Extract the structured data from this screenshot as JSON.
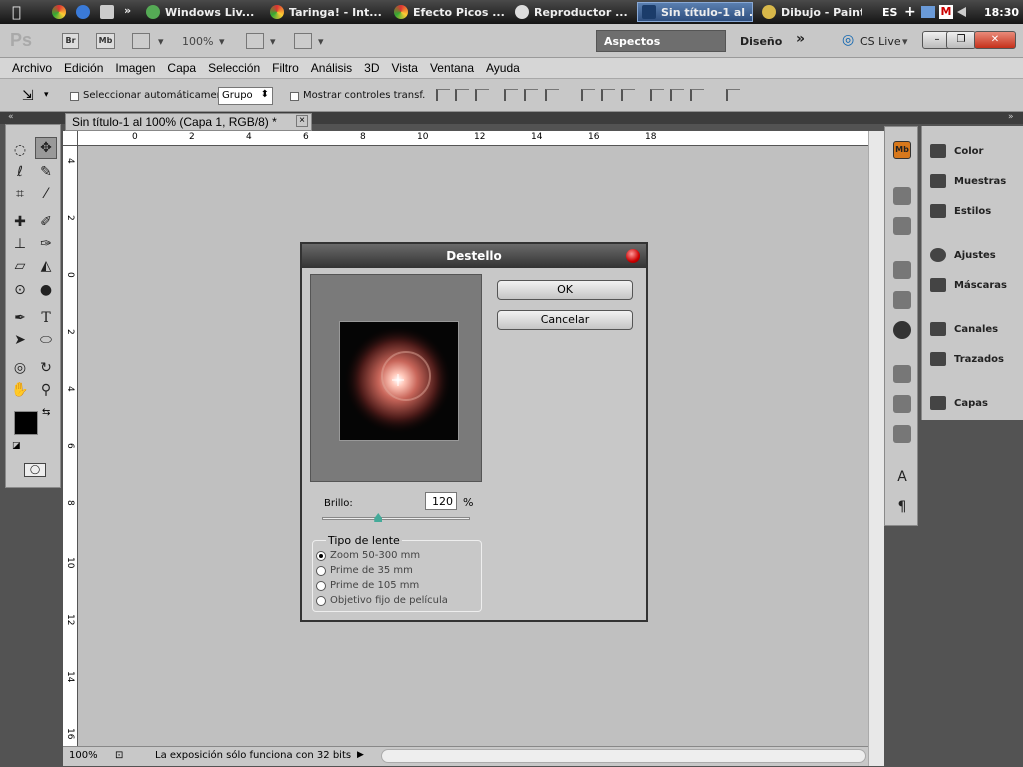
{
  "taskbar": {
    "items": [
      {
        "label": "Windows Liv..."
      },
      {
        "label": "Taringa! - Int..."
      },
      {
        "label": "Efecto Picos ..."
      },
      {
        "label": "Reproductor ..."
      },
      {
        "label": "Sin título-1 al ..."
      },
      {
        "label": "Dibujo - Paint"
      }
    ],
    "lang": "ES",
    "clock": "18:30",
    "more": "»"
  },
  "appbar": {
    "logo": "Ps",
    "br": "Br",
    "mb": "Mb",
    "zoom": "100%",
    "workspace_active": "Aspectos esenciales",
    "workspace_design": "Diseño",
    "workspace_more": "»",
    "cslive": "CS Live"
  },
  "menu": [
    "Archivo",
    "Edición",
    "Imagen",
    "Capa",
    "Selección",
    "Filtro",
    "Análisis",
    "3D",
    "Vista",
    "Ventana",
    "Ayuda"
  ],
  "options": {
    "auto_select": "Seleccionar automáticamente:",
    "auto_select_value": "Grupo",
    "transform": "Mostrar controles transf."
  },
  "document": {
    "tab": "Sin título-1 al 100% (Capa 1, RGB/8) *",
    "close": "×",
    "hruler": [
      "4",
      "2",
      "0",
      "2",
      "4",
      "6",
      "8",
      "10",
      "12",
      "14",
      "16",
      "18"
    ],
    "vruler": [
      "4",
      "2",
      "0",
      "2",
      "4",
      "6",
      "8",
      "10",
      "12",
      "14",
      "16"
    ],
    "zoom": "100%",
    "status": "La exposición sólo funciona con 32 bits"
  },
  "dialog": {
    "title": "Destello",
    "ok": "OK",
    "cancel": "Cancelar",
    "brightness_label": "Brillo:",
    "brightness_value": "120",
    "brightness_unit": "%",
    "brightness_slider": 0.38,
    "lens_group": "Tipo de lente",
    "lens_options": [
      "Zoom 50-300 mm",
      "Prime de 35 mm",
      "Prime de 105 mm",
      "Objetivo fijo de película"
    ],
    "lens_selected": 0
  },
  "panels": [
    {
      "label": "Color",
      "icon": "color-icon"
    },
    {
      "label": "Muestras",
      "icon": "swatches-icon"
    },
    {
      "label": "Estilos",
      "icon": "styles-icon"
    },
    {
      "label": "Ajustes",
      "icon": "adjustments-icon"
    },
    {
      "label": "Máscaras",
      "icon": "masks-icon"
    },
    {
      "label": "Canales",
      "icon": "channels-icon"
    },
    {
      "label": "Trazados",
      "icon": "paths-icon"
    },
    {
      "label": "Capas",
      "icon": "layers-icon"
    }
  ]
}
